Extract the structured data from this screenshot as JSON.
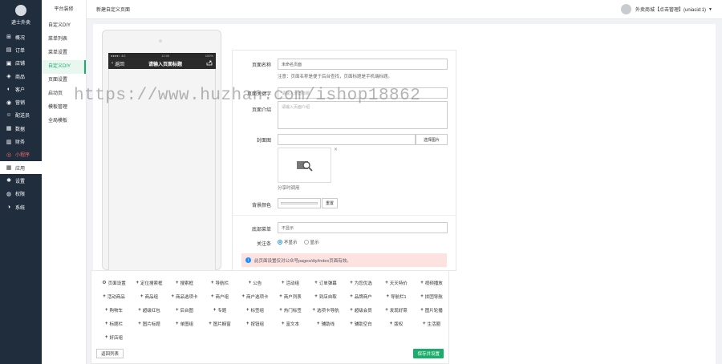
{
  "brand": {
    "name": "递士外卖"
  },
  "left_nav": [
    {
      "icon": "store-icon",
      "label": "概况",
      "state": "normal"
    },
    {
      "icon": "order-icon",
      "label": "订单",
      "state": "normal"
    },
    {
      "icon": "shop-icon",
      "label": "店铺",
      "state": "normal"
    },
    {
      "icon": "goods-icon",
      "label": "商品",
      "state": "normal"
    },
    {
      "icon": "customer-icon",
      "label": "客户",
      "state": "normal"
    },
    {
      "icon": "marketing-icon",
      "label": "营销",
      "state": "normal"
    },
    {
      "icon": "rider-icon",
      "label": "配送员",
      "state": "normal"
    },
    {
      "icon": "data-icon",
      "label": "数据",
      "state": "normal"
    },
    {
      "icon": "finance-icon",
      "label": "财务",
      "state": "normal"
    },
    {
      "icon": "miniapp-icon",
      "label": "小程序",
      "state": "red"
    },
    {
      "icon": "app-icon",
      "label": "应用",
      "state": "active"
    },
    {
      "icon": "settings-icon",
      "label": "设置",
      "state": "normal"
    },
    {
      "icon": "permission-icon",
      "label": "权限",
      "state": "normal"
    },
    {
      "icon": "system-icon",
      "label": "系统",
      "state": "normal"
    }
  ],
  "sub_nav": {
    "title": "平台装修",
    "items": [
      {
        "label": "自定义DIY",
        "active": false
      },
      {
        "label": "菜单列表",
        "active": false
      },
      {
        "label": "菜单设置",
        "active": false
      },
      {
        "label": "自定义DIY",
        "active": true
      },
      {
        "label": "页面设置",
        "active": false
      },
      {
        "label": "启动页",
        "active": false
      }
    ],
    "section_label": "模板管理",
    "section_items": [
      {
        "label": "全局模板"
      }
    ]
  },
  "topbar": {
    "breadcrumb": "新建自定义页面",
    "user": "外卖商城【点击管理】(uniacid:1)"
  },
  "phone": {
    "status_left": "●●●●○ 4G",
    "status_time": "12:00",
    "status_right": "100%",
    "back_label": "返回",
    "page_title": "请输入页面标题"
  },
  "form": {
    "page_name_label": "页面名称",
    "page_name_value": "未命名页面",
    "page_name_note": "注意：页面名称是便于后台查找，页面标题是手机端标题。",
    "page_keyword_label": "页面关键字",
    "page_keyword_placeholder": "请输入页面标题",
    "page_desc_label": "页面介绍",
    "page_desc_placeholder": "请输入页面介绍",
    "cover_label": "封面图",
    "choose_image": "选择图片",
    "share_image_hint": "分享时调用",
    "bg_color_label": "背景颜色",
    "reset": "重置",
    "bottom_menu_label": "底部菜单",
    "bottom_menu_value": "不显示",
    "follow_label": "关注条",
    "follow_options": [
      {
        "label": "不显示",
        "checked": true
      },
      {
        "label": "显示",
        "checked": false
      }
    ],
    "alert": "此页面设置仅对公众号pages/diy/index页面有效。"
  },
  "components": {
    "items": [
      "页面设置",
      "定位搜索框",
      "搜索框",
      "导航栏",
      "公告",
      "活动组",
      "订单弹幕",
      "为您优选",
      "天天特价",
      "视频播放",
      "活动商品",
      "商品组",
      "商品选项卡",
      "商户组",
      "商户选项卡",
      "商户列表",
      "到店自取",
      "品牌商户",
      "导航栏1",
      "拼团导航",
      "购物车",
      "超级红包",
      "后台图",
      "专题",
      "标签组",
      "热门标签",
      "选项卡导航",
      "超级会员",
      "发现好菜",
      "图片轮播",
      "标题栏",
      "图片标题",
      "单图组",
      "图片橱窗",
      "按钮组",
      "富文本",
      "辅助线",
      "辅助空白",
      "版权",
      "生活圈",
      "好店组"
    ],
    "back_button": "返回列表",
    "save_button": "保存并设置"
  },
  "watermark": "https://www.huzhan.com/ishop18862"
}
